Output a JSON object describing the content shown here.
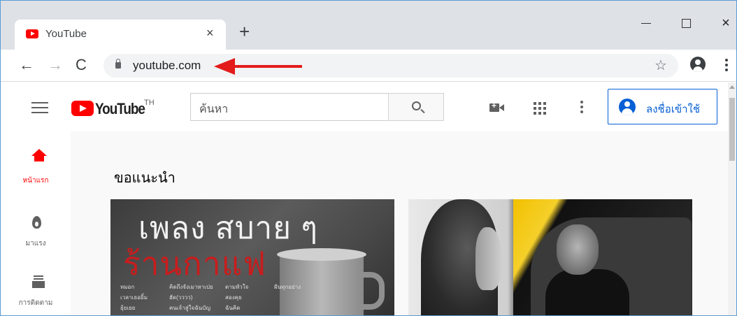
{
  "browser": {
    "tab_title": "YouTube",
    "tab_close": "×",
    "new_tab": "+",
    "window_close": "×",
    "url": "youtube.com",
    "back": "←",
    "forward": "→",
    "reload": "C",
    "star": "☆"
  },
  "annotation": {
    "arrow_color": "#e31b1b"
  },
  "youtube": {
    "logo_text": "YouTube",
    "country_code": "TH",
    "search_placeholder": "ค้นหา",
    "signin_label": "ลงชื่อเข้าใช้",
    "brand_color": "#ff0000",
    "accent_color": "#065fd4",
    "sidebar": {
      "items": [
        {
          "label": "หน้าแรก",
          "icon": "home-icon",
          "active": true
        },
        {
          "label": "มาแรง",
          "icon": "flame-icon",
          "active": false
        },
        {
          "label": "การติดตาม",
          "icon": "subscriptions-icon",
          "active": false
        }
      ]
    },
    "section_title": "ขอแนะนำ",
    "videos": [
      {
        "thumb_line1": "เพลง สบาย ๆ",
        "thumb_line2": "ร้านกาแฟ",
        "thumb_list": [
          "หมอก",
          "คิดถึงจังเมาหาเปย",
          "ตามหัวใจ",
          "ฝันทุกอย่าง",
          "เวลาเธอยิ้ม",
          "ฮัด(วววว)",
          "สองคุย",
          "ยุ้ยเยย",
          "คนเจ้าสู่ใจฉันบัญ",
          "ฉันคิด"
        ]
      },
      {}
    ]
  }
}
